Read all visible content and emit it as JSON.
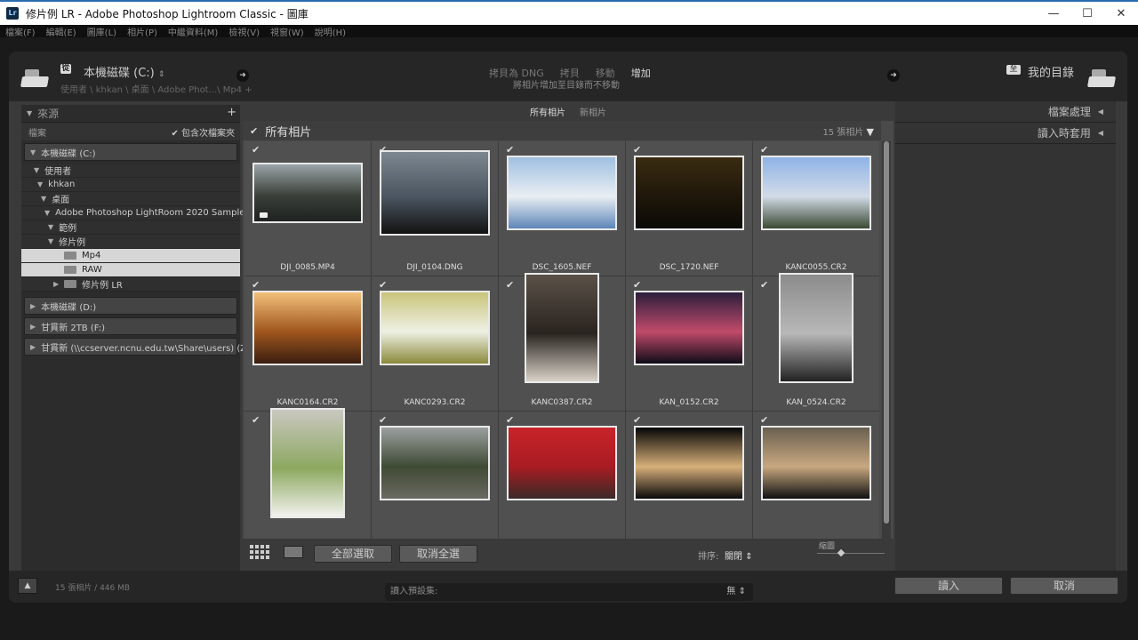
{
  "window": {
    "title": "修片例 LR - Adobe Photoshop Lightroom Classic - 圖庫",
    "app_icon": "Lr",
    "minimize": "—",
    "maximize": "☐",
    "close": "✕"
  },
  "menu": [
    "檔案(F)",
    "編輯(E)",
    "圖庫(L)",
    "相片(P)",
    "中繼資料(M)",
    "檢視(V)",
    "視窗(W)",
    "說明(H)"
  ],
  "source": {
    "badge": "從",
    "title": "本機磁碟 (C:)",
    "path": "使用者 \\ khkan \\ 桌面 \\ Adobe Phot...\\ Mp4 +",
    "header": "來源",
    "files_label": "檔案",
    "include_subfolders": "包含次檔案夾"
  },
  "modes": {
    "items": [
      "拷貝為 DNG",
      "拷貝",
      "移動",
      "增加"
    ],
    "active_index": 3,
    "description": "將相片增加至目錄而不移動"
  },
  "destination": {
    "badge": "至",
    "title": "我的目錄"
  },
  "tree": [
    {
      "label": "本機磁碟 (C:)",
      "level": 0,
      "type": "drive",
      "expanded": true
    },
    {
      "label": "使用者",
      "level": 1,
      "type": "folder"
    },
    {
      "label": "khkan",
      "level": 2,
      "type": "folder"
    },
    {
      "label": "桌面",
      "level": 3,
      "type": "folder"
    },
    {
      "label": "Adobe Photoshop LightRoom 2020 Sample",
      "level": 4,
      "type": "folder"
    },
    {
      "label": "範例",
      "level": 5,
      "type": "folder"
    },
    {
      "label": "修片例",
      "level": 5,
      "type": "folder"
    },
    {
      "label": "Mp4",
      "level": 6,
      "type": "leaf",
      "selected": true
    },
    {
      "label": "RAW",
      "level": 6,
      "type": "leaf",
      "selected": true
    },
    {
      "label": "修片例 LR",
      "level": 6,
      "type": "leaf-collapsed"
    }
  ],
  "drives": [
    {
      "label": "本機磁碟 (D:)"
    },
    {
      "label": "甘貫新 2TB (F:)"
    },
    {
      "label": "甘貫新 (\\\\ccserver.ncnu.edu.tw\\Share\\users) (Z:)"
    }
  ],
  "grid": {
    "tabs": [
      "所有相片",
      "新相片"
    ],
    "active_tab": 0,
    "title": "所有相片",
    "count": "15 張相片",
    "photos": [
      {
        "name": "DJI_0085.MP4",
        "w": 124,
        "h": 68,
        "colors": [
          "#9aa4a8",
          "#3a3f38",
          "#1e2220"
        ],
        "checked": true,
        "video": true
      },
      {
        "name": "DJI_0104.DNG",
        "w": 124,
        "h": 96,
        "colors": [
          "#7c8790",
          "#4a5560",
          "#121212"
        ],
        "checked": true
      },
      {
        "name": "DSC_1605.NEF",
        "w": 124,
        "h": 84,
        "colors": [
          "#9fc0e0",
          "#e9eef3",
          "#5d86b8"
        ],
        "checked": true
      },
      {
        "name": "DSC_1720.NEF",
        "w": 124,
        "h": 84,
        "colors": [
          "#3a2c12",
          "#1f170a",
          "#0c0a06"
        ],
        "checked": true
      },
      {
        "name": "KANC0055.CR2",
        "w": 124,
        "h": 84,
        "colors": [
          "#8fb3e6",
          "#d2dbe8",
          "#3b4a33"
        ],
        "checked": true
      },
      {
        "name": "KANC0164.CR2",
        "w": 124,
        "h": 84,
        "colors": [
          "#f2c07a",
          "#a0561e",
          "#3a1e10"
        ],
        "checked": true
      },
      {
        "name": "KANC0293.CR2",
        "w": 124,
        "h": 84,
        "colors": [
          "#c9c47a",
          "#eef0e4",
          "#8b8a3c"
        ],
        "checked": true
      },
      {
        "name": "KANC0387.CR2",
        "w": 84,
        "h": 124,
        "colors": [
          "#5a5248",
          "#2a2420",
          "#d8d2c8"
        ],
        "checked": true
      },
      {
        "name": "KAN_0152.CR2",
        "w": 124,
        "h": 84,
        "colors": [
          "#2b1f3c",
          "#c14a6a",
          "#0f0c18"
        ],
        "checked": true
      },
      {
        "name": "KAN_0524.CR2",
        "w": 84,
        "h": 124,
        "colors": [
          "#8c8c8c",
          "#b8b8b8",
          "#222222"
        ],
        "checked": true
      },
      {
        "name": "",
        "w": 84,
        "h": 124,
        "colors": [
          "#c9c8c0",
          "#8da860",
          "#f2f2ee"
        ],
        "checked": true
      },
      {
        "name": "",
        "w": 124,
        "h": 84,
        "colors": [
          "#9ba0a0",
          "#3f4a34",
          "#6a6a62"
        ],
        "checked": true
      },
      {
        "name": "",
        "w": 124,
        "h": 84,
        "colors": [
          "#c8242a",
          "#a81c22",
          "#3a2a28"
        ],
        "checked": true
      },
      {
        "name": "",
        "w": 124,
        "h": 84,
        "colors": [
          "#050505",
          "#d7b07a",
          "#0a0a0a"
        ],
        "checked": true
      },
      {
        "name": "",
        "w": 124,
        "h": 84,
        "colors": [
          "#6a6050",
          "#c8a880",
          "#111111"
        ],
        "checked": true
      }
    ],
    "select_all": "全部選取",
    "deselect_all": "取消全選",
    "sort_label": "排序:",
    "sort_value": "關閉",
    "thumb_label": "縮圖"
  },
  "right": {
    "file_handling": "檔案處理",
    "apply_during_import": "讀入時套用"
  },
  "footer": {
    "summary": "15 張相片 / 446 MB",
    "preset_label": "讀入預設集:",
    "preset_value": "無",
    "import_button": "讀入",
    "cancel_button": "取消"
  },
  "colors": {
    "accent_blue": "#2b6cb0",
    "panel_dark": "#262626",
    "grid_bg": "#4a4a4a"
  }
}
